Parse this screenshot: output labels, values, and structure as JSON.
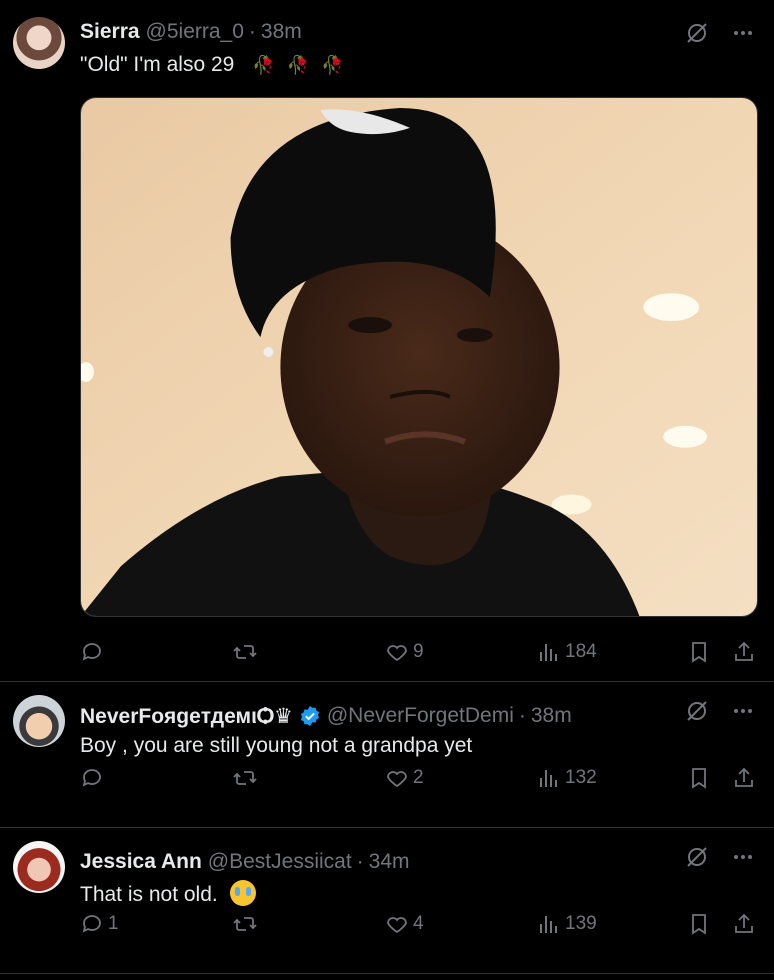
{
  "tweets": [
    {
      "name": "Sierra",
      "handle": "@5ierra_0",
      "time": "38m",
      "text": "\"Old\" I'm also 29",
      "likes": "9",
      "views": "184",
      "replies": ""
    },
    {
      "name": "NeverFoяgeтдемιѺ♛",
      "handle": "@NeverForgetDemi",
      "time": "38m",
      "text": "Boy , you are still young not a grandpa yet",
      "likes": "2",
      "views": "132",
      "replies": ""
    },
    {
      "name": "Jessica Ann",
      "handle": "@BestJessiicat",
      "time": "34m",
      "text": "That is not old.",
      "likes": "4",
      "views": "139",
      "replies": "1"
    }
  ],
  "colors": {
    "background": "#000000",
    "text": "#e7e9ea",
    "muted": "#71767b",
    "border": "#2f3336",
    "verified": "#1d9bf0"
  }
}
